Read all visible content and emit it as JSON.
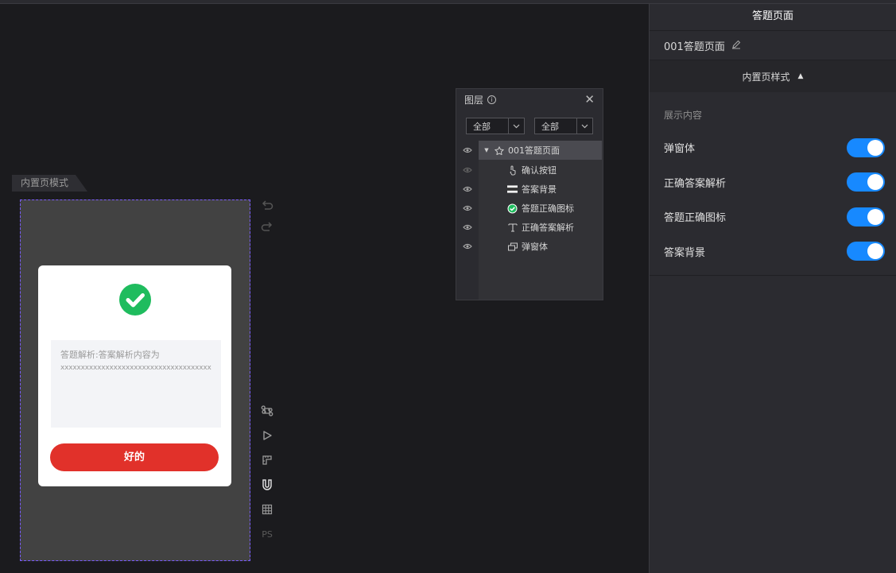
{
  "canvas": {
    "mode_tag": "内置页模式"
  },
  "dialog": {
    "analysis_line1": "答题解析:答案解析内容为",
    "analysis_line2": "xxxxxxxxxxxxxxxxxxxxxxxxxxxxxxxxxxxxxxxx",
    "ok_label": "好的",
    "check_color": "#1fbc5e",
    "button_color": "#e1312a"
  },
  "tools": {
    "ps_label": "PS"
  },
  "layers": {
    "title": "图层",
    "filter1": "全部",
    "filter2": "全部",
    "rows": [
      {
        "label": "001答题页面",
        "icon": "component-icon"
      },
      {
        "label": "确认按钮",
        "icon": "pointer-icon"
      },
      {
        "label": "答案背景",
        "icon": "image-icon"
      },
      {
        "label": "答题正确图标",
        "icon": "check-icon"
      },
      {
        "label": "正确答案解析",
        "icon": "text-icon"
      },
      {
        "label": "弹窗体",
        "icon": "window-icon"
      }
    ]
  },
  "right_panel": {
    "title": "答题页面",
    "page_name": "001答题页面",
    "section": "内置页样式",
    "caption": "展示内容",
    "options": [
      {
        "label": "弹窗体",
        "on": true
      },
      {
        "label": "正确答案解析",
        "on": true
      },
      {
        "label": "答题正确图标",
        "on": true
      },
      {
        "label": "答案背景",
        "on": true
      }
    ],
    "toggle_color": "#1789ff"
  }
}
